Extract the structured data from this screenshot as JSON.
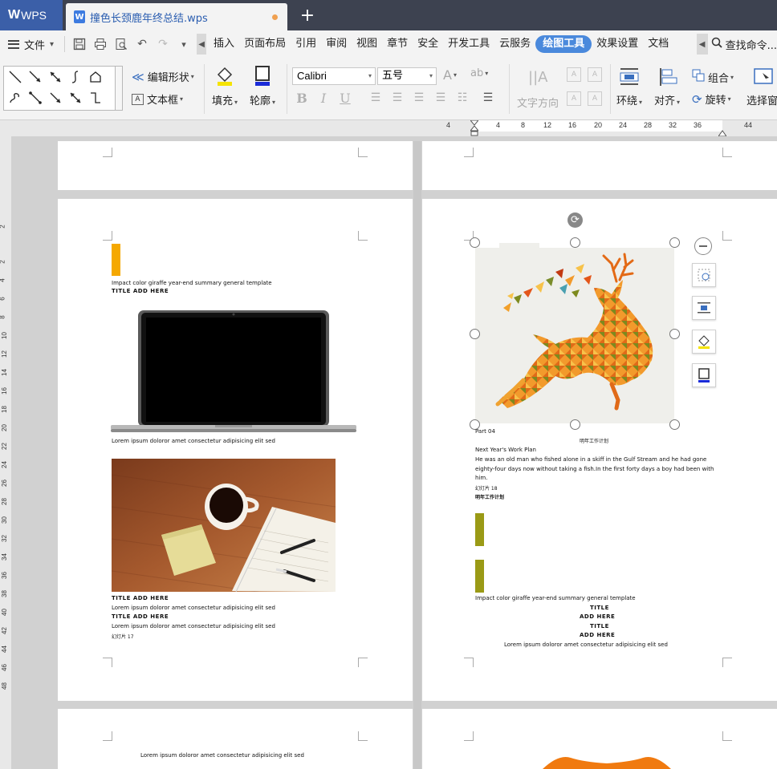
{
  "titlebar": {
    "app_name": "WPS",
    "doc_title": "撞色长颈鹿年终总结.wps",
    "new_tab": "+"
  },
  "menubar": {
    "file_label": "文件",
    "items": [
      "插入",
      "页面布局",
      "引用",
      "审阅",
      "视图",
      "章节",
      "安全",
      "开发工具",
      "云服务",
      "绘图工具",
      "效果设置",
      "文档"
    ],
    "active_item": "绘图工具",
    "search_label": "查找命令..."
  },
  "ribbon": {
    "edit_shape": "编辑形状",
    "text_box": "文本框",
    "fill": "填充",
    "outline": "轮廓",
    "font_name": "Calibri",
    "font_size": "五号",
    "text_direction": "文字方向",
    "wrap": "环绕",
    "align": "对齐",
    "group": "组合",
    "rotate": "旋转",
    "select_pane": "选择窗"
  },
  "ruler": {
    "h_numbers": [
      "4",
      "4",
      "8",
      "12",
      "16",
      "20",
      "24",
      "28",
      "32",
      "36",
      "44"
    ],
    "v_numbers": [
      "2",
      "2",
      "4",
      "6",
      "8",
      "10",
      "12",
      "14",
      "16",
      "18",
      "20",
      "22",
      "24",
      "26",
      "28",
      "30",
      "32",
      "34",
      "36",
      "38",
      "40",
      "42",
      "44",
      "46",
      "48"
    ]
  },
  "left_page": {
    "subtitle": "Impact color giraffe year-end summary general template",
    "title_1": "TITLE  ADD  HERE",
    "caption_laptop": "Lorem ipsum doloror amet consectetur adipisicing elit sed",
    "title_2": "TITLE  ADD  HERE",
    "caption_2": "Lorem ipsum doloror amet consectetur adipisicing elit sed",
    "title_3": "TITLE  ADD  HERE",
    "caption_3": "Lorem ipsum doloror amet consectetur adipisicing elit sed",
    "slide_label": "幻灯片 17"
  },
  "right_page": {
    "part": "Part 04",
    "caption_cn": "明年工作计划",
    "plan_title": "Next Year's Work Plan",
    "plan_body": "He was an old man who fished alone in a skiff in the Gulf Stream and he had gone eighty-four days now without taking a fish.In the first forty days a boy had been with him.",
    "slide_label": "幻灯片 18",
    "plan_cn": "明年工作计划",
    "subtitle": "Impact color giraffe year-end summary general template",
    "title_a": "TITLE",
    "title_b": "ADD  HERE",
    "title_c": "TITLE",
    "title_d": "ADD  HERE",
    "caption": "Lorem ipsum doloror amet consectetur adipisicing elit sed"
  },
  "bottom_left_page": {
    "caption": "Lorem ipsum doloror amet consectetur adipisicing elit sed"
  },
  "colors": {
    "accent_blue": "#4a89dc",
    "yellow_bar": "#f5a800",
    "olive_bar": "#9a9a16",
    "orange_shape": "#f07a10"
  }
}
